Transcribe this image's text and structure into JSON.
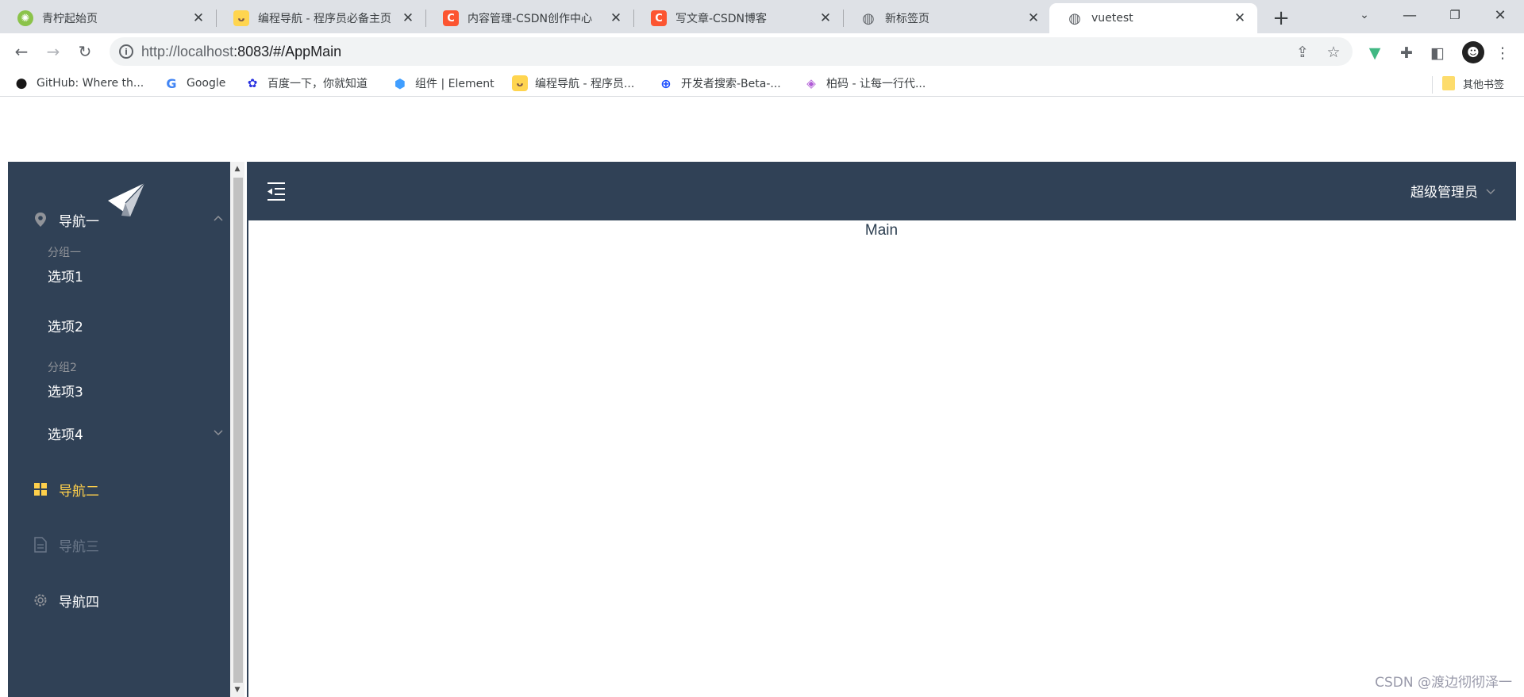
{
  "browser": {
    "tabs": [
      {
        "title": "青柠起始页",
        "icon": "lime-icon",
        "active": false
      },
      {
        "title": "编程导航 - 程序员必备主页",
        "icon": "duck-icon",
        "active": false
      },
      {
        "title": "内容管理-CSDN创作中心",
        "icon": "csdn-icon",
        "active": false
      },
      {
        "title": "写文章-CSDN博客",
        "icon": "csdn-icon",
        "active": false
      },
      {
        "title": "新标签页",
        "icon": "globe-icon",
        "active": false
      },
      {
        "title": "vuetest",
        "icon": "globe-icon",
        "active": true
      }
    ],
    "url_host": "http://localhost",
    "url_rest": ":8083/#/AppMain",
    "bookmarks": [
      {
        "label": "GitHub: Where th...",
        "icon": "github-icon"
      },
      {
        "label": "Google",
        "icon": "google-icon"
      },
      {
        "label": "百度一下，你就知道",
        "icon": "baidu-icon"
      },
      {
        "label": "组件 | Element",
        "icon": "element-icon"
      },
      {
        "label": "编程导航 - 程序员...",
        "icon": "duck-icon"
      },
      {
        "label": "开发者搜索-Beta-...",
        "icon": "search-icon"
      },
      {
        "label": "柏码 - 让每一行代...",
        "icon": "diamond-icon"
      }
    ],
    "other_bookmarks": "其他书签"
  },
  "sidebar": {
    "nav1": {
      "label": "导航一",
      "icon": "location-icon",
      "expanded": true
    },
    "group1": "分组一",
    "option1": "选项1",
    "option2": "选项2",
    "group2": "分组2",
    "option3": "选项3",
    "option4": "选项4",
    "nav2": {
      "label": "导航二",
      "icon": "grid-icon",
      "active": true
    },
    "nav3": {
      "label": "导航三",
      "icon": "document-icon",
      "disabled": true
    },
    "nav4": {
      "label": "导航四",
      "icon": "gear-icon"
    }
  },
  "header": {
    "user": "超级管理员"
  },
  "main": {
    "text": "Main"
  },
  "watermark": "CSDN @渡边彻彻泽一",
  "colors": {
    "sidebar_bg": "#304156",
    "active_text": "#ffd04b",
    "group_text": "#909399"
  }
}
